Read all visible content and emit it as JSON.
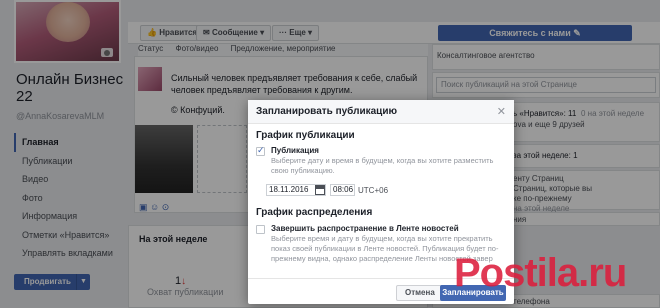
{
  "page": {
    "name": "Онлайн Бизнес 22",
    "handle": "@AnnaKosarevaMLM",
    "promote_label": "Продвигать"
  },
  "left_nav": {
    "items": [
      {
        "label": "Главная"
      },
      {
        "label": "Публикации"
      },
      {
        "label": "Видео"
      },
      {
        "label": "Фото"
      },
      {
        "label": "Информация"
      },
      {
        "label": "Отметки «Нравится»"
      },
      {
        "label": "Управлять вкладками"
      }
    ]
  },
  "action_bar": {
    "like_label": "Нравится",
    "message_label": "Сообщение",
    "more_label": "Еще",
    "contact_label": "Свяжитесь с нами"
  },
  "composer": {
    "tabs": [
      "Статус",
      "Фото/видео",
      "Предложение, мероприятие"
    ]
  },
  "post": {
    "text": "Сильный человек предъявляет требования к себе, слабый человек предъявляет требования к другим.",
    "quote": "© Конфуций."
  },
  "this_week": {
    "title": "На этой неделе",
    "count": "1",
    "label": "Охват публикации"
  },
  "right_col": {
    "category": "Консалтинговое агентство",
    "search_placeholder": "Поиск публикаций на этой Странице",
    "likes_line1": "ь «Нравится»: 11",
    "likes_line1b": "0 на этой неделе",
    "likes_line2": "ova и еще 9 друзей",
    "visits_line": "за этой неделе: 1",
    "pages_title": "енту Страниц",
    "pages_desc1": "Страниц, которые вы",
    "pages_desc2": "ке по-прежнему",
    "pages_desc3": "на этой неделе",
    "apps": "ния",
    "phone": "телефона"
  },
  "modal": {
    "title": "Запланировать публикацию",
    "schedule_section": "График публикации",
    "publication_label": "Публикация",
    "publication_desc": "Выберите дату и время в будущем, когда вы хотите разместить свою публикацию.",
    "date_value": "18.11.2016",
    "time_value": "08:06",
    "timezone": "UTC+06",
    "distribution_section": "График распределения",
    "stop_label": "Завершить распространение в Ленте новостей",
    "stop_desc": "Выберите время и дату в будущем, когда вы хотите прекратить показ своей публикации в Ленте новостей. Публикация будет по-прежнему видна, однако распределение Ленты новостей завер",
    "cancel_label": "Отмена",
    "schedule_label": "Запланировать"
  },
  "watermark": {
    "text": "Postila.ru"
  }
}
